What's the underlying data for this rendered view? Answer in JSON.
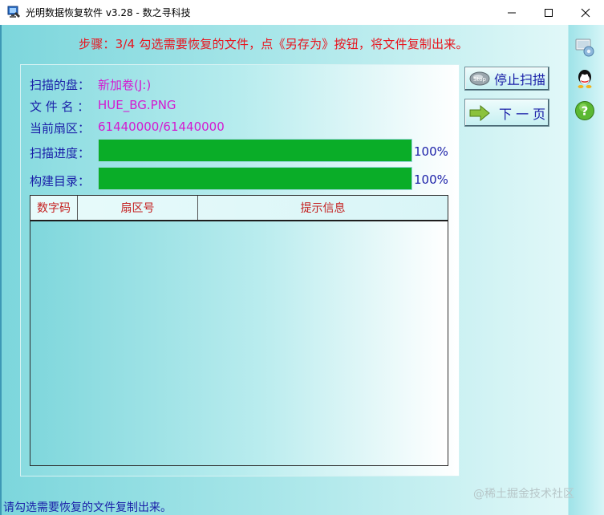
{
  "window": {
    "title": "光明数据恢复软件 v3.28 - 数之寻科技",
    "min_icon": "minimize-icon",
    "max_icon": "maximize-icon",
    "close_icon": "close-icon"
  },
  "step": {
    "text": "步骤：3/4 勾选需要恢复的文件，点《另存为》按钮，将文件复制出来。"
  },
  "scan": {
    "disk_label": "扫描的盘：",
    "disk_value": "新加卷(J:)",
    "file_label": "文 件 名 ：",
    "file_value": "HUE_BG.PNG",
    "sector_label": "当前扇区：",
    "sector_value": "61440000/61440000",
    "progress_label": "扫描进度：",
    "progress_percent": "100%",
    "progress_value": 1.0,
    "build_label": "构建目录：",
    "build_percent": "100%",
    "build_value": 1.0
  },
  "table": {
    "columns": [
      "数字码",
      "扇区号",
      "提示信息"
    ],
    "rows": []
  },
  "buttons": {
    "stop_label": "停止扫描",
    "stop_icon": "stop-icon",
    "next_label": "下 一 页",
    "next_icon": "arrow-right-icon"
  },
  "sidebar": {
    "icons": [
      "settings-icon",
      "qq-icon",
      "help-icon"
    ]
  },
  "status": {
    "text": "请勾选需要恢复的文件复制出来。"
  },
  "watermark": {
    "text": "@稀土掘金技术社区"
  },
  "colors": {
    "step_text": "#e8141e",
    "label_text": "#1a1fa8",
    "value_text": "#d41ad0",
    "progress_fill": "#0aad28",
    "column_header_text": "#c41f1f"
  }
}
